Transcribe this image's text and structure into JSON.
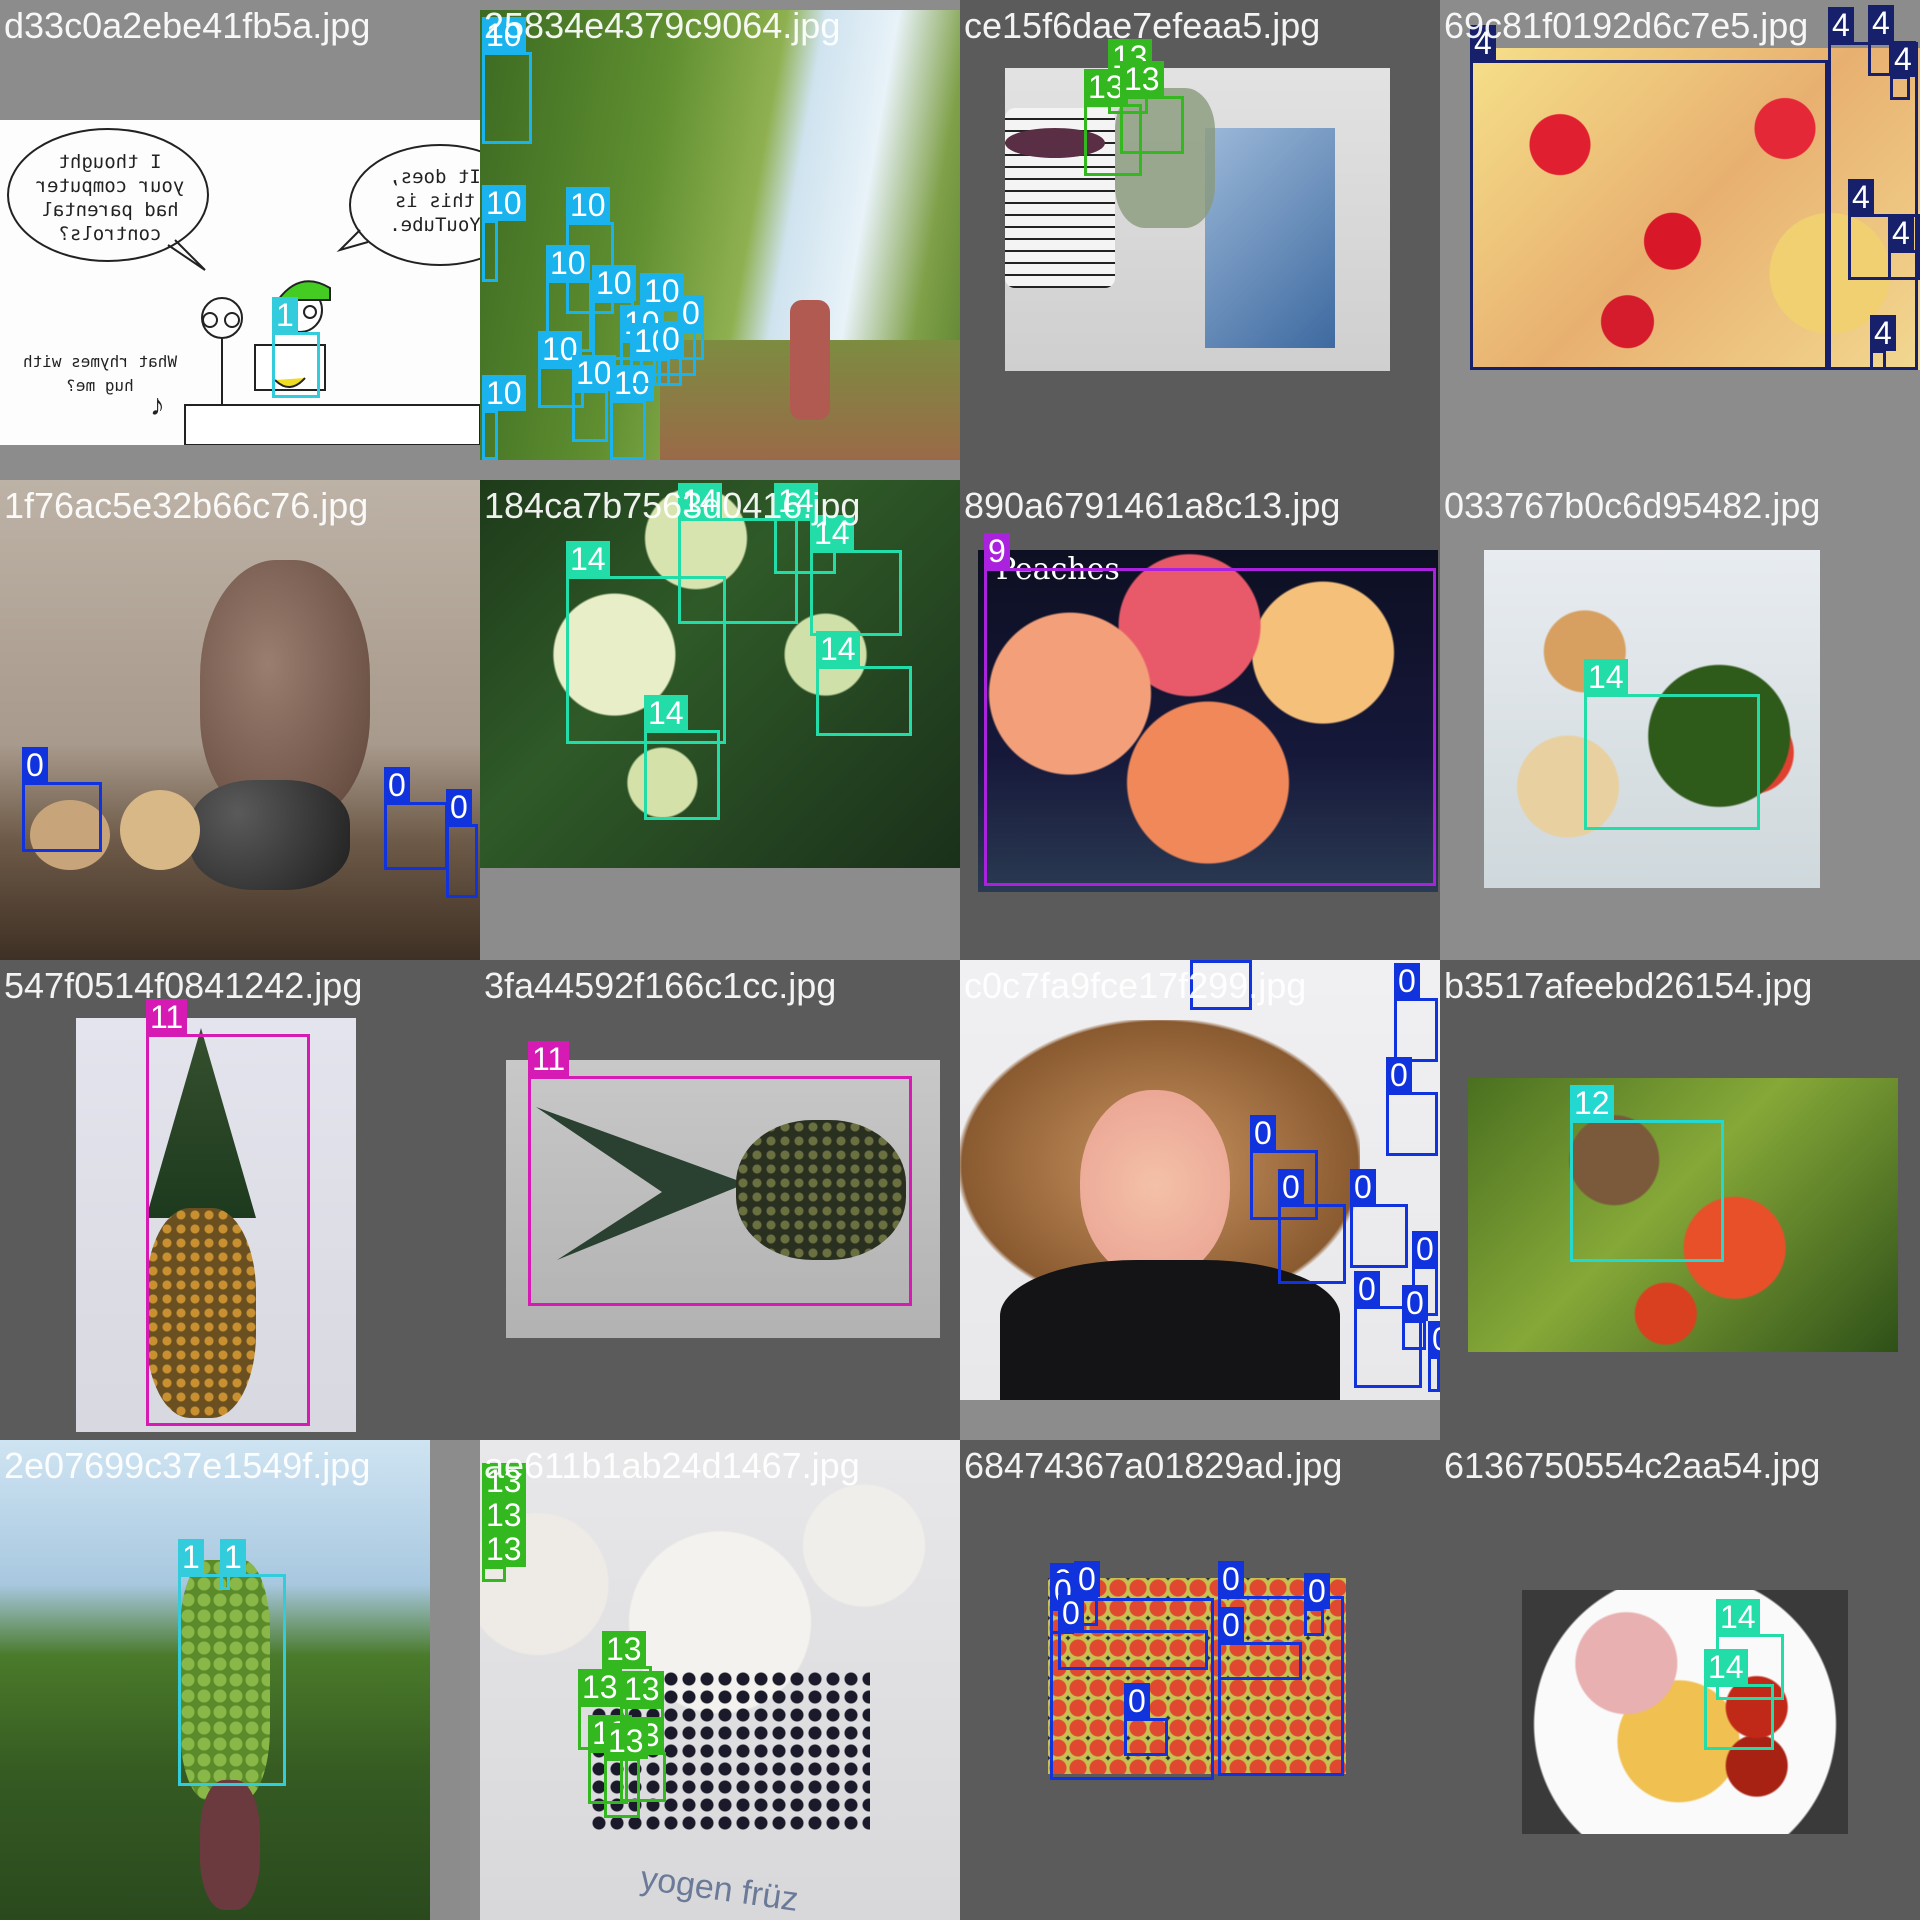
{
  "mosaic": {
    "tiles": [
      {
        "filename": "d33c0a2ebe41fb5a.jpg",
        "scene": "comic",
        "boxes": [
          {
            "label": "1",
            "class": 1
          }
        ]
      },
      {
        "filename": "25834e4379c9064.jpg",
        "scene": "pear-orchard",
        "boxes": [
          {
            "label": "10",
            "class": 10
          },
          {
            "label": "10",
            "class": 10
          },
          {
            "label": "10",
            "class": 10
          },
          {
            "label": "10",
            "class": 10
          },
          {
            "label": "10",
            "class": 10
          },
          {
            "label": "10",
            "class": 10
          },
          {
            "label": "10",
            "class": 10
          },
          {
            "label": "10",
            "class": 10
          },
          {
            "label": "10",
            "class": 10
          },
          {
            "label": "10",
            "class": 10
          },
          {
            "label": "10",
            "class": 10
          },
          {
            "label": "10",
            "class": 10
          },
          {
            "label": "0",
            "class": 10
          },
          {
            "label": "0",
            "class": 10
          }
        ]
      },
      {
        "filename": "ce15f6dae7efeaa5.jpg",
        "scene": "tea",
        "boxes": [
          {
            "label": "13",
            "class": 13
          },
          {
            "label": "13",
            "class": 13
          },
          {
            "label": "13",
            "class": 13
          }
        ]
      },
      {
        "filename": "69c81f0192d6c7e5.jpg",
        "scene": "fruit-salad",
        "boxes": [
          {
            "label": "4",
            "class": 4
          },
          {
            "label": "4",
            "class": 4
          },
          {
            "label": "4",
            "class": 4
          },
          {
            "label": "4",
            "class": 4
          },
          {
            "label": "4",
            "class": 4
          },
          {
            "label": "4",
            "class": 4
          },
          {
            "label": "4",
            "class": 4
          }
        ]
      },
      {
        "filename": "1f76ac5e32b66c76.jpg",
        "scene": "still-life",
        "boxes": [
          {
            "label": "0",
            "class": 0
          },
          {
            "label": "0",
            "class": 0
          },
          {
            "label": "0",
            "class": 0
          }
        ]
      },
      {
        "filename": "184ca7b7563d0416.jpg",
        "scene": "tomato-plant",
        "boxes": [
          {
            "label": "14",
            "class": 14
          },
          {
            "label": "14",
            "class": 14
          },
          {
            "label": "14",
            "class": 14
          },
          {
            "label": "14",
            "class": 14
          },
          {
            "label": "14",
            "class": 14
          },
          {
            "label": "14",
            "class": 14
          }
        ]
      },
      {
        "filename": "890a6791461a8c13.jpg",
        "scene": "peaches",
        "photo_caption": "Peaches",
        "boxes": [
          {
            "label": "9",
            "class": 9
          }
        ]
      },
      {
        "filename": "033767b0c6d95482.jpg",
        "scene": "salad-plate",
        "boxes": [
          {
            "label": "14",
            "class": 14
          }
        ]
      },
      {
        "filename": "547f0514f0841242.jpg",
        "scene": "pineapple-upright",
        "boxes": [
          {
            "label": "11",
            "class": 11
          }
        ]
      },
      {
        "filename": "3fa44592f166c1cc.jpg",
        "scene": "pineapple-lying",
        "boxes": [
          {
            "label": "11",
            "class": 11
          }
        ]
      },
      {
        "filename": "c0c7fa9fce17f299.jpg",
        "scene": "woman-apples",
        "boxes": [
          {
            "label": "0",
            "class": 0
          },
          {
            "label": "0",
            "class": 0
          },
          {
            "label": "0",
            "class": 0
          },
          {
            "label": "0",
            "class": 0
          },
          {
            "label": "0",
            "class": 0
          },
          {
            "label": "0",
            "class": 0
          },
          {
            "label": "0",
            "class": 0
          },
          {
            "label": "0",
            "class": 0
          },
          {
            "label": "0",
            "class": 0
          },
          {
            "label": "0",
            "class": 0
          }
        ]
      },
      {
        "filename": "b3517afeebd26154.jpg",
        "scene": "pomegranate",
        "boxes": [
          {
            "label": "12",
            "class": 12
          }
        ]
      },
      {
        "filename": "2e07699c37e1549f.jpg",
        "scene": "banana-tree",
        "boxes": [
          {
            "label": "1",
            "class": 1
          },
          {
            "label": "1",
            "class": 1
          }
        ]
      },
      {
        "filename": "ae611b1ab24d1467.jpg",
        "scene": "frozen-yogurt",
        "photo_caption": "yogen früz",
        "boxes": [
          {
            "label": "13",
            "class": 13
          },
          {
            "label": "13",
            "class": 13
          },
          {
            "label": "13",
            "class": 13
          },
          {
            "label": "13",
            "class": 13
          },
          {
            "label": "13",
            "class": 13
          },
          {
            "label": "13",
            "class": 13
          },
          {
            "label": "13",
            "class": 13
          },
          {
            "label": "13",
            "class": 13
          },
          {
            "label": "13",
            "class": 13
          }
        ]
      },
      {
        "filename": "68474367a01829ad.jpg",
        "scene": "apple-crates",
        "boxes": [
          {
            "label": "0",
            "class": 0
          },
          {
            "label": "0",
            "class": 0
          },
          {
            "label": "0",
            "class": 0
          },
          {
            "label": "0",
            "class": 0
          },
          {
            "label": "0",
            "class": 0
          },
          {
            "label": "0",
            "class": 0
          },
          {
            "label": "0",
            "class": 0
          },
          {
            "label": "0",
            "class": 0
          }
        ]
      },
      {
        "filename": "6136750554c2aa54.jpg",
        "scene": "salad-bowl",
        "boxes": [
          {
            "label": "14",
            "class": 14
          },
          {
            "label": "14",
            "class": 14
          }
        ]
      }
    ]
  },
  "comic": {
    "bubble_left": [
      "I thought",
      "your computer",
      "had parental",
      "controls?"
    ],
    "bubble_right": [
      "It does,",
      "this is",
      "YouTube."
    ],
    "bottom_left": [
      "What rhymes with",
      "hug me?"
    ]
  },
  "class_colors": {
    "0": "#1133dd",
    "1": "#33ccdd",
    "4": "#16206b",
    "9": "#aa22dd",
    "10": "#1ab3ee",
    "11": "#d61bb5",
    "12": "#22d8d0",
    "13": "#33b81f",
    "14": "#22dda8"
  }
}
